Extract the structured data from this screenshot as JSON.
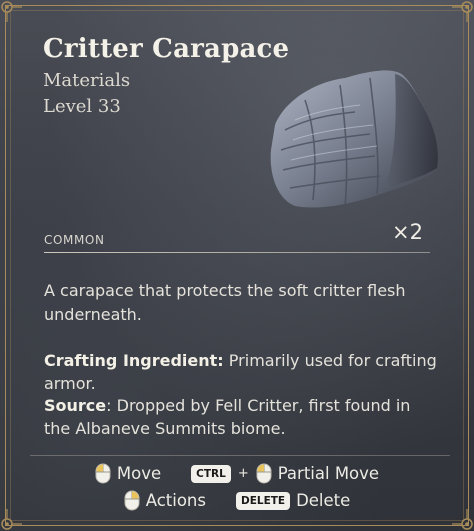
{
  "item": {
    "name": "Critter Carapace",
    "category": "Materials",
    "level": "Level 33",
    "rarity": "COMMON",
    "quantity": "×2",
    "description": "A carapace that protects the soft critter flesh underneath.",
    "crafting_label": "Crafting Ingredient:",
    "crafting_text": "Primarily used for crafting armor.",
    "source_label": "Source",
    "source_text": ": Dropped by Fell Critter, first found in the Albaneve Summits biome."
  },
  "controls": {
    "move_label": "Move",
    "ctrl_key": "CTRL",
    "plus": "+",
    "partial_move_label": "Partial Move",
    "actions_label": "Actions",
    "delete_key": "DELETE",
    "delete_label": "Delete"
  },
  "colors": {
    "frame_gold": "#a88d5a",
    "panel_bg": "#3b3e46",
    "key_bg": "#f2f0ea",
    "mouse_button_highlight": "#e8c45a"
  },
  "icons": [
    "corner-ornament-icon",
    "item-carapace-icon",
    "left-mouse-icon",
    "right-mouse-icon"
  ]
}
